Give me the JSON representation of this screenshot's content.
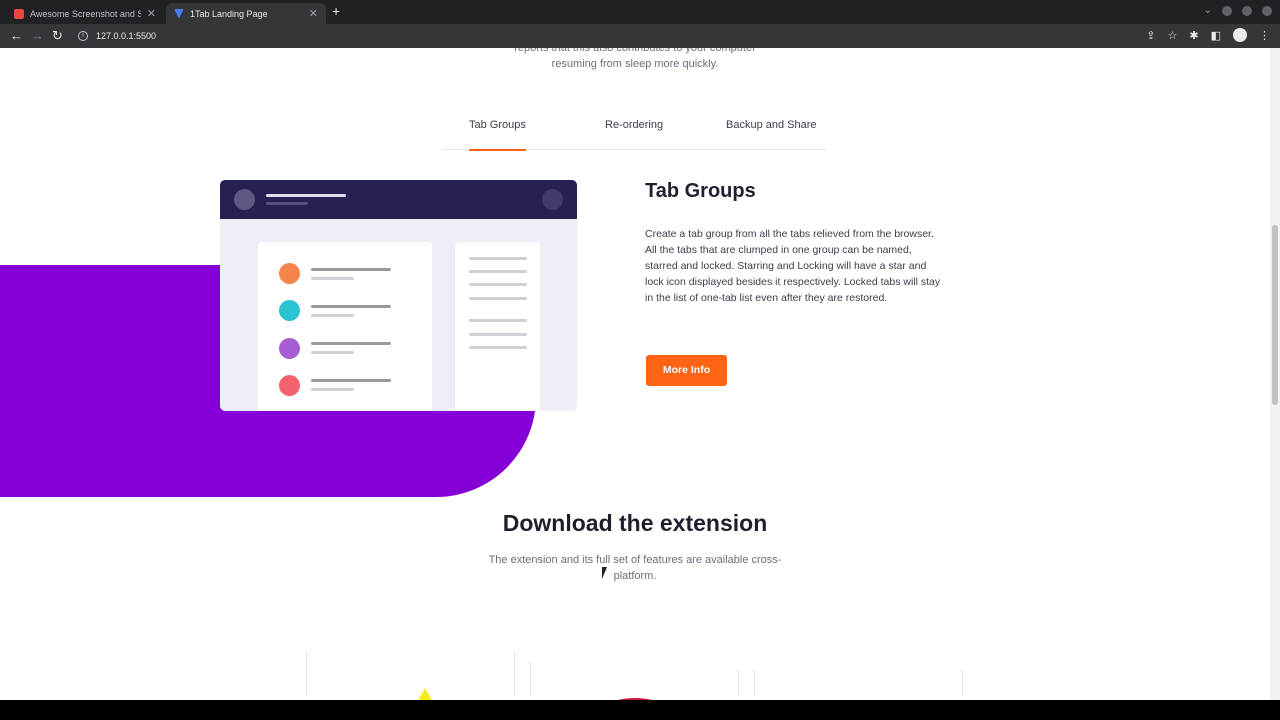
{
  "browser": {
    "tabs": [
      {
        "title": "Awesome Screenshot and Sc",
        "favicon_color": "#e8453c"
      },
      {
        "title": "1Tab Landing Page",
        "favicon_color": "#4a7cf6"
      }
    ],
    "new_tab_icon": "+",
    "url": "127.0.0.1:5500"
  },
  "intro": {
    "line1": "reports that this also contributes to your computer",
    "line2": "resuming from sleep more quickly."
  },
  "feature_tabs": [
    {
      "label": "Tab Groups",
      "active": true
    },
    {
      "label": "Re-ordering",
      "active": false
    },
    {
      "label": "Backup and Share",
      "active": false
    }
  ],
  "feature": {
    "title": "Tab Groups",
    "description": "Create a tab group from all the tabs relieved from the browser. All the tabs that are clumped in one group can be named, starred and locked. Starring and Locking will have a star and lock icon displayed besides it respectively. Locked tabs will stay in the list of one-tab list even after they are restored.",
    "button_label": "More Info"
  },
  "mockup": {
    "dot_colors": [
      "#f5844c",
      "#2bc2d2",
      "#a65dd6",
      "#f2626e"
    ]
  },
  "download": {
    "title": "Download the extension",
    "text": "The extension and its full set of features are available cross-platform."
  },
  "colors": {
    "accent": "#ff6416",
    "purple": "#8500d6",
    "navy": "#252152"
  }
}
